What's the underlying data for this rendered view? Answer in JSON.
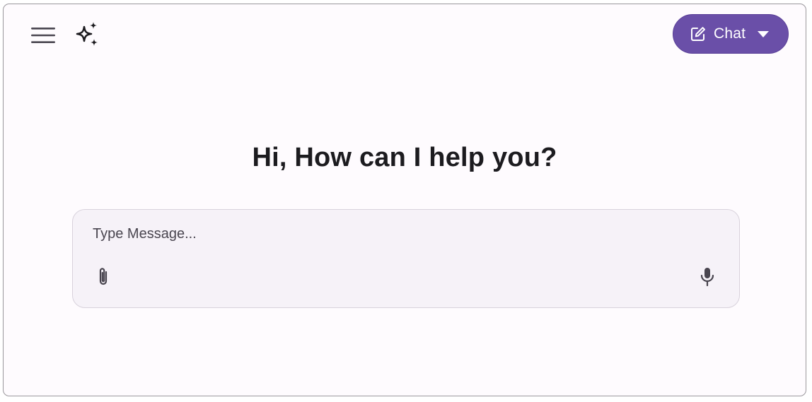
{
  "header": {
    "menu_icon": "hamburger-menu-icon",
    "logo_icon": "sparkle-icon",
    "mode_button": {
      "label": "Chat",
      "icon": "edit-icon",
      "dropdown_icon": "caret-down-icon",
      "color": "#6a4fa8"
    }
  },
  "main": {
    "greeting": "Hi, How can I help you?",
    "composer": {
      "placeholder": "Type Message...",
      "value": "",
      "attach_icon": "paperclip-icon",
      "voice_icon": "microphone-icon"
    }
  },
  "colors": {
    "background": "#fefbfe",
    "accent": "#6a4fa8",
    "input_background": "#f6f2f8",
    "text": "#1c1b1f"
  }
}
